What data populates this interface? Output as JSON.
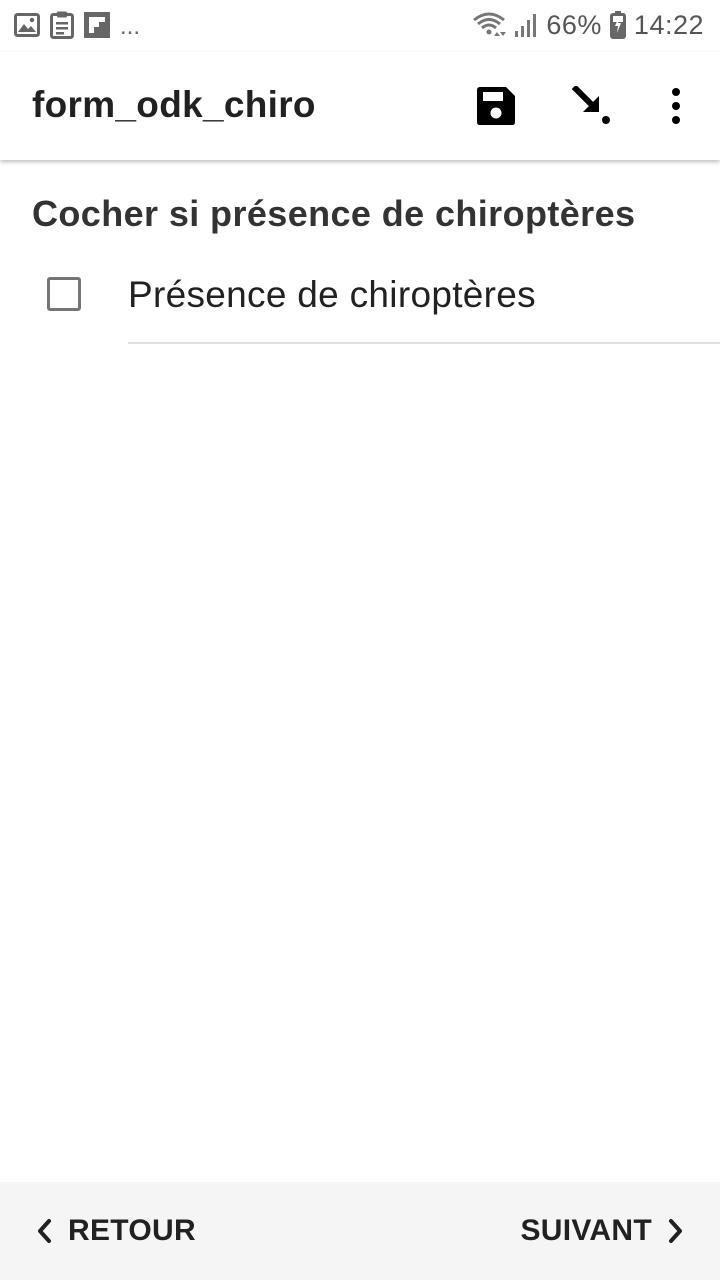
{
  "status_bar": {
    "icons_left": [
      "image-icon",
      "clipboard-icon",
      "flipboard-icon"
    ],
    "overflow": "...",
    "battery_percent": "66%",
    "time": "14:22",
    "icons_right": [
      "wifi-icon",
      "signal-icon",
      "battery-icon"
    ]
  },
  "app_bar": {
    "title": "form_odk_chiro",
    "actions": [
      "save-icon",
      "jump-icon",
      "more-vert-icon"
    ]
  },
  "question": {
    "label": "Cocher si présence de chiroptères",
    "choices": [
      {
        "label": "Présence de chiroptères",
        "checked": false
      }
    ]
  },
  "navigation": {
    "back_label": "RETOUR",
    "next_label": "SUIVANT"
  },
  "colors": {
    "background": "#ffffff",
    "text": "#212121",
    "bottom_bar": "#f5f5f5",
    "checkbox_border": "#757575"
  }
}
